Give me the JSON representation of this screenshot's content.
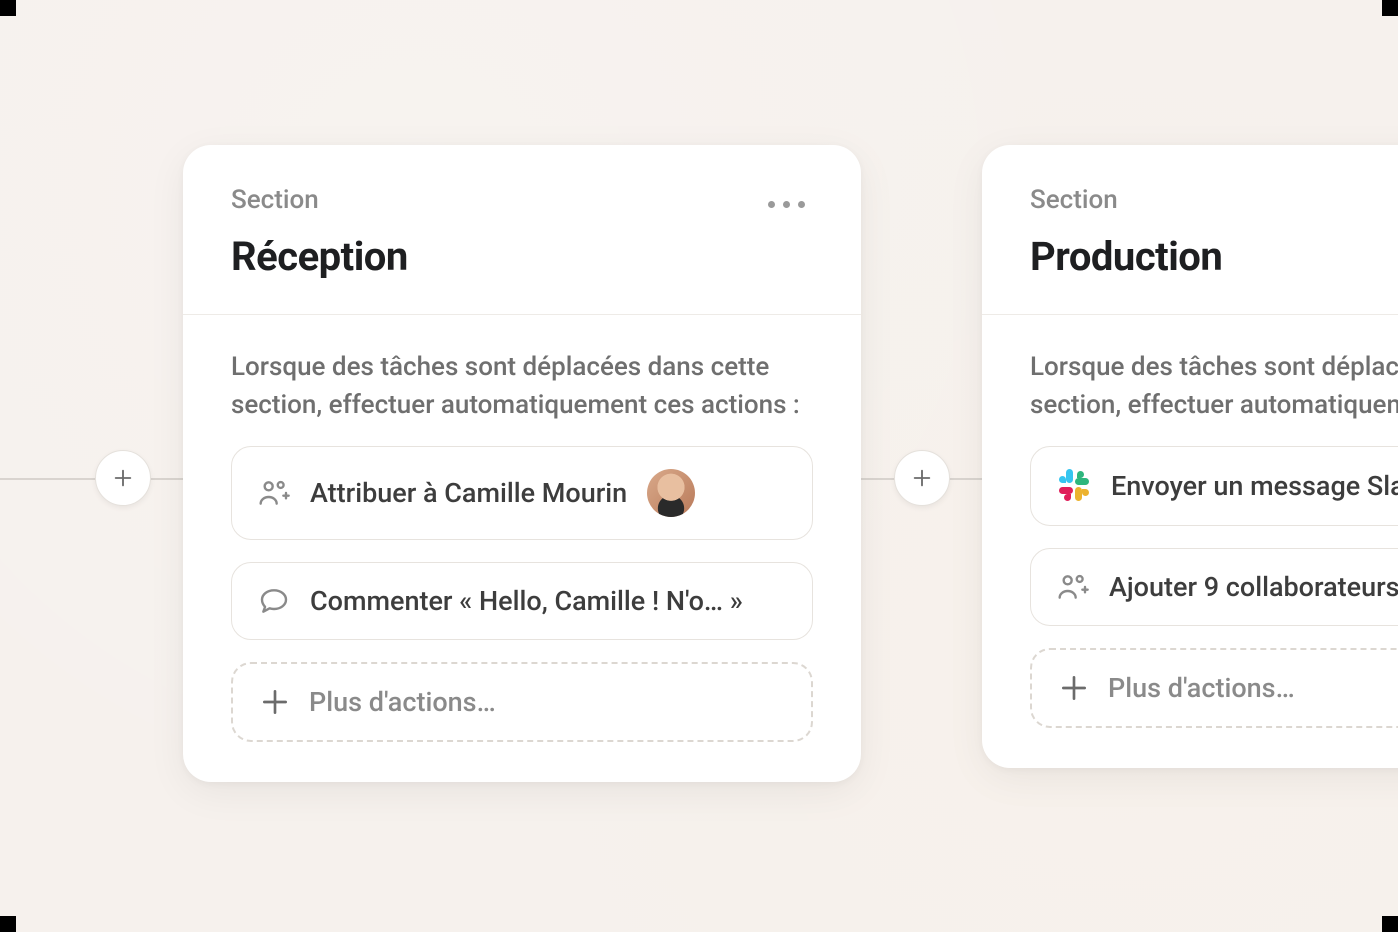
{
  "section_label": "Section",
  "cards": {
    "reception": {
      "title": "Réception",
      "trigger": "Lorsque des tâches sont déplacées dans cette section, effectuer automatiquement ces actions :",
      "actions": [
        {
          "icon": "people-plus",
          "label": "Attribuer à Camille Mourin",
          "has_avatar": true
        },
        {
          "icon": "comment",
          "label": "Commenter « Hello, Camille ! N'o… »"
        }
      ],
      "add_more": "Plus d'actions…"
    },
    "production": {
      "title": "Production",
      "trigger_partial": "Lorsque des tâches sont déplacées dans cette section, effectuer automatiquement ces actions :",
      "actions": [
        {
          "icon": "slack",
          "label": "Envoyer un message Slack"
        },
        {
          "icon": "people-plus",
          "label": "Ajouter 9 collaborateurs"
        }
      ],
      "add_more": "Plus d'actions…"
    }
  }
}
